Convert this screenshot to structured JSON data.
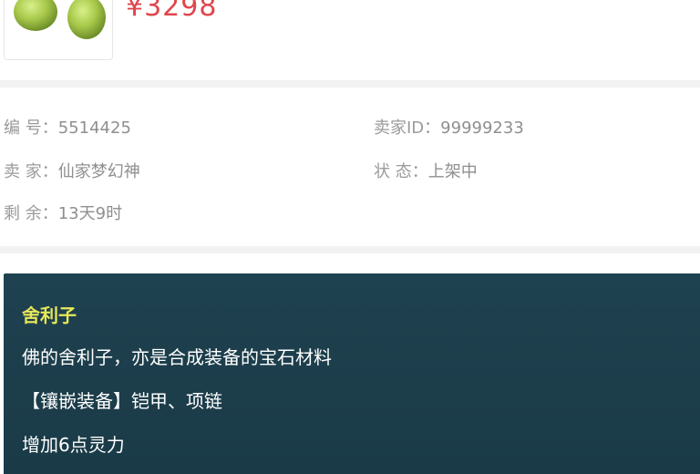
{
  "item": {
    "price": "¥3298"
  },
  "details": {
    "serial_label": "编 号：",
    "serial_value": "5514425",
    "seller_id_label": "卖家ID：",
    "seller_id_value": "99999233",
    "seller_label": "卖 家：",
    "seller_value": "仙家梦幻神",
    "status_label": "状 态：",
    "status_value": "上架中",
    "remaining_label": "剩 余：",
    "remaining_value": "13天9时"
  },
  "description": {
    "name": "舍利子",
    "lines": [
      "佛的舍利子，亦是合成装备的宝石材料",
      "【镶嵌装备】铠甲、项链",
      "增加6点灵力"
    ]
  },
  "colors": {
    "price": "#e0464c",
    "desc_bg": "#1f4250",
    "item_name": "#e8e85a"
  },
  "icons": {
    "item_image": "green-gem-icon"
  }
}
